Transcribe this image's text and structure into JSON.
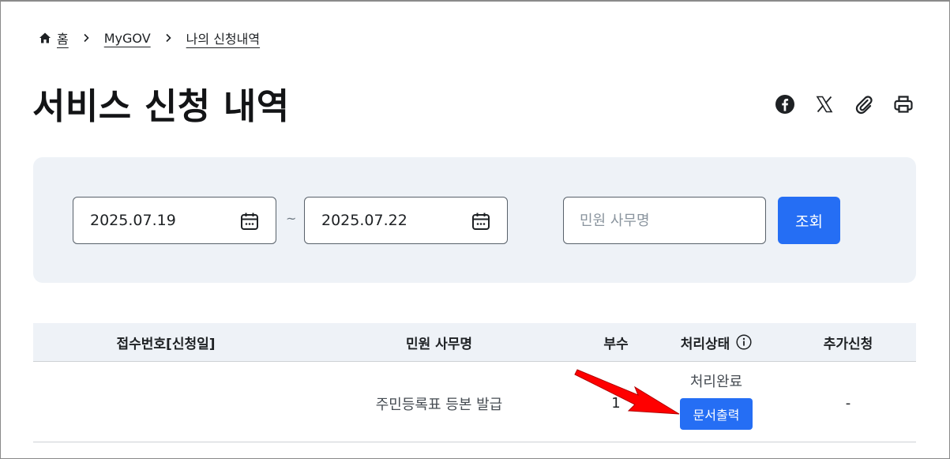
{
  "breadcrumb": {
    "items": [
      {
        "label": "홈"
      },
      {
        "label": "MyGOV"
      },
      {
        "label": "나의 신청내역"
      }
    ]
  },
  "page": {
    "title": "서비스 신청 내역"
  },
  "share": {
    "icons": [
      "facebook-icon",
      "x-icon",
      "paperclip-icon",
      "printer-icon"
    ]
  },
  "search": {
    "date_from": "2025.07.19",
    "date_to": "2025.07.22",
    "range_separator": "~",
    "keyword_placeholder": "민원 사무명",
    "submit_label": "조회"
  },
  "table": {
    "columns": [
      "접수번호[신청일]",
      "민원 사무명",
      "부수",
      "처리상태",
      "추가신청"
    ],
    "rows": [
      {
        "receipt": "",
        "service_name": "주민등록표 등본 발급",
        "count": "1",
        "status": "처리완료",
        "action_label": "문서출력",
        "extra": "-"
      }
    ]
  },
  "colors": {
    "accent": "#256ef4",
    "panel_bg": "#eef2f7",
    "annotation_arrow": "#ff0000"
  }
}
